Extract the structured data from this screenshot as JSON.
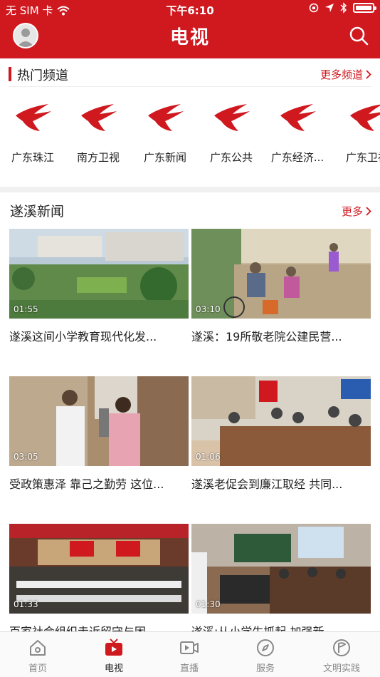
{
  "status_bar": {
    "carrier": "无 SIM 卡",
    "time": "下午6:10"
  },
  "header": {
    "title": "电视"
  },
  "hot_channels": {
    "title": "热门频道",
    "more_label": "更多频道",
    "items": [
      {
        "label": "广东珠江"
      },
      {
        "label": "南方卫视"
      },
      {
        "label": "广东新闻"
      },
      {
        "label": "广东公共"
      },
      {
        "label": "广东经济..."
      },
      {
        "label": "广东卫视"
      }
    ]
  },
  "news": {
    "title": "遂溪新闻",
    "more_label": "更多",
    "items": [
      {
        "duration": "01:55",
        "caption": "遂溪这间小学教育现代化发..."
      },
      {
        "duration": "03:10",
        "caption": "遂溪：19所敬老院公建民营..."
      },
      {
        "duration": "03:05",
        "caption": "受政策惠泽 靠己之勤劳 这位..."
      },
      {
        "duration": "01:06",
        "caption": "遂溪老促会到廉江取经 共同..."
      },
      {
        "duration": "01:33",
        "caption": "百家社会组织走近留守与困"
      },
      {
        "duration": "01:30",
        "caption": "遂溪:从小学生抓起  加强新"
      }
    ]
  },
  "tabbar": {
    "items": [
      {
        "label": "首页"
      },
      {
        "label": "电视"
      },
      {
        "label": "直播"
      },
      {
        "label": "服务"
      },
      {
        "label": "文明实践"
      }
    ]
  },
  "colors": {
    "brand": "#d0181f"
  }
}
